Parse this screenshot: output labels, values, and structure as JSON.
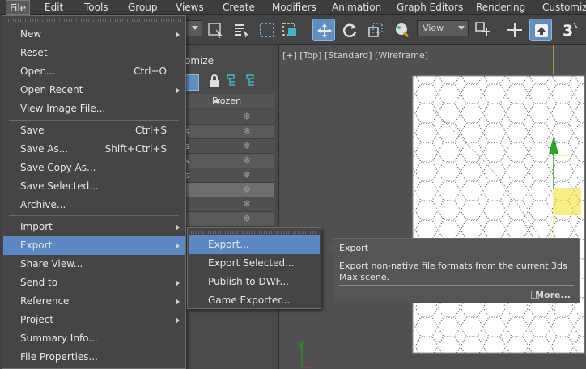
{
  "menubar": {
    "items": [
      {
        "label": "File",
        "active": true
      },
      {
        "label": "Edit"
      },
      {
        "label": "Tools"
      },
      {
        "label": "Group"
      },
      {
        "label": "Views"
      },
      {
        "label": "Create"
      },
      {
        "label": "Modifiers"
      },
      {
        "label": "Animation"
      },
      {
        "label": "Graph Editors"
      },
      {
        "label": "Rendering"
      },
      {
        "label": "Customize"
      }
    ]
  },
  "toolbar": {
    "view_combo": "View",
    "tools": [
      "select-object-icon",
      "select-by-name-icon",
      "rectangular-selection-icon",
      "window-crossing-icon",
      "select-and-move-icon",
      "select-and-rotate-icon",
      "select-and-scale-icon",
      "select-and-place-icon",
      "use-pivot-icon",
      "select-and-manipulate-icon",
      "keyboard-shortcut-toggle-icon",
      "snaps-toggle-icon"
    ],
    "snap_label": "3"
  },
  "file_menu": {
    "items": [
      {
        "label": "New",
        "shortcut": "",
        "submenu": true
      },
      {
        "label": "Reset",
        "shortcut": "",
        "submenu": false
      },
      {
        "label": "Open...",
        "shortcut": "Ctrl+O",
        "submenu": false
      },
      {
        "label": "Open Recent",
        "shortcut": "",
        "submenu": true
      },
      {
        "label": "View Image File...",
        "shortcut": "",
        "submenu": false
      },
      {
        "label": "Save",
        "shortcut": "Ctrl+S",
        "submenu": false
      },
      {
        "label": "Save As...",
        "shortcut": "Shift+Ctrl+S",
        "submenu": false
      },
      {
        "label": "Save Copy As...",
        "shortcut": "",
        "submenu": false
      },
      {
        "label": "Save Selected...",
        "shortcut": "",
        "submenu": false
      },
      {
        "label": "Archive...",
        "shortcut": "",
        "submenu": false
      },
      {
        "label": "Import",
        "shortcut": "",
        "submenu": true
      },
      {
        "label": "Export",
        "shortcut": "",
        "submenu": true,
        "highlighted": true
      },
      {
        "label": "Share View...",
        "shortcut": "",
        "submenu": false
      },
      {
        "label": "Send to",
        "shortcut": "",
        "submenu": true
      },
      {
        "label": "Reference",
        "shortcut": "",
        "submenu": true
      },
      {
        "label": "Project",
        "shortcut": "",
        "submenu": true
      },
      {
        "label": "Summary Info...",
        "shortcut": "",
        "submenu": false
      },
      {
        "label": "File Properties...",
        "shortcut": "",
        "submenu": false
      }
    ]
  },
  "export_submenu": {
    "items": [
      {
        "label": "Export...",
        "highlighted": true
      },
      {
        "label": "Export Selected..."
      },
      {
        "label": "Publish to DWF..."
      },
      {
        "label": "Game Exporter..."
      }
    ]
  },
  "tooltip": {
    "title": "Export",
    "description": "Export non-native file formats from the current 3ds Max scene.",
    "more_label": "More..."
  },
  "explorer": {
    "title_fragment": "omize",
    "column_header": "Frozen",
    "row_fragments": [
      "l",
      "s",
      "s",
      "s",
      "s",
      "",
      "",
      "l"
    ]
  },
  "viewport": {
    "label": "[+] [Top] [Standard] [Wireframe]"
  },
  "colors": {
    "highlight": "#5b87c3",
    "menu_bg": "#454545",
    "active_tool": "#5f8fbf",
    "gizmo_green": "#22aa22",
    "gizmo_yellow": "#f0e020"
  }
}
